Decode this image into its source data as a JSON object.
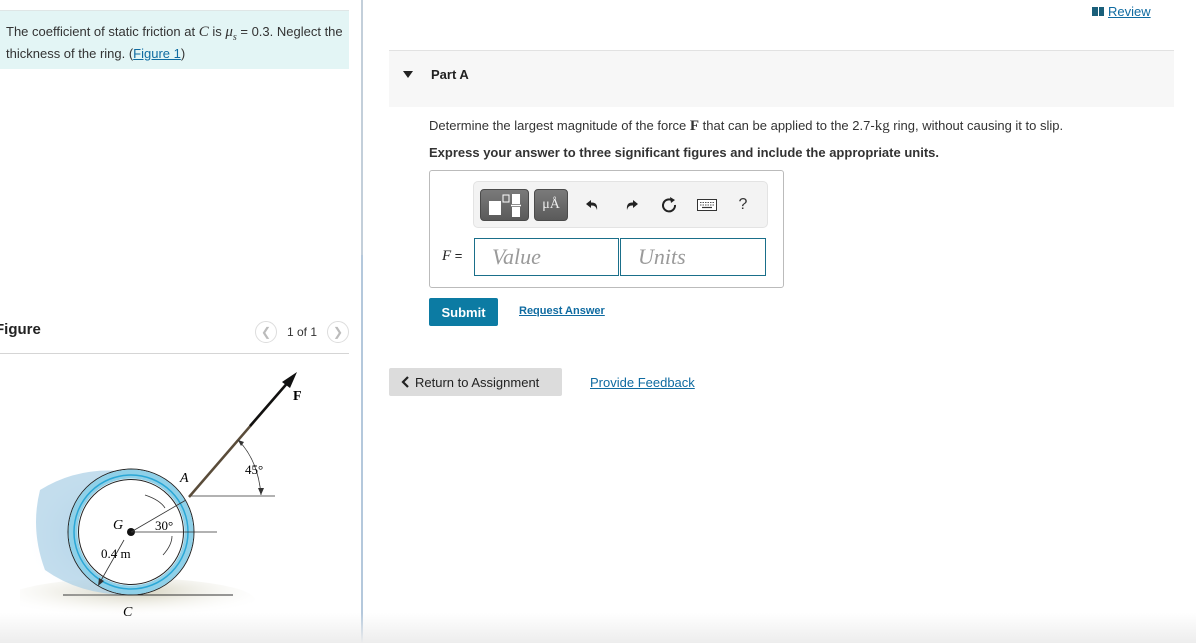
{
  "intro": {
    "text_before": "The coefficient of static friction at ",
    "point": "C",
    "text_is": " is ",
    "mu_symbol": "μ",
    "mu_sub": "s",
    "mu_value": " = 0.3. Neglect the thickness of the ring. (",
    "figure_link": "Figure 1",
    "text_after": ")"
  },
  "figure": {
    "title": "Figure",
    "counter": "1 of 1",
    "prev_icon": "chevron-left-icon",
    "next_icon": "chevron-right-icon",
    "labels": {
      "force": "F",
      "point_a": "A",
      "point_g": "G",
      "point_c": "C",
      "angle_force": "45°",
      "angle_radius": "30°",
      "radius": "0.4 m"
    },
    "colors": {
      "ring": "#6ec3e2",
      "ring_dark": "#2aa7d6",
      "shadow": "#a9cfe6",
      "ground": "#d8d6c6"
    }
  },
  "header": {
    "review_label": " Review",
    "review_icon": "book-icon"
  },
  "part": {
    "title": "Part A",
    "expanded": true,
    "question_before": "Determine the largest magnitude of the force ",
    "question_force": "F",
    "question_middle": " that can be applied to the 2.7-",
    "question_unit": "kg",
    "question_after": " ring, without causing it to slip.",
    "instruction": "Express your answer to three significant figures and include the appropriate units."
  },
  "answer": {
    "variable": "F",
    "equals": " =",
    "value_placeholder": "Value",
    "units_placeholder": "Units",
    "value": "",
    "units": "",
    "toolbar": {
      "template_icon": "templates-icon",
      "units_label": "μÅ",
      "undo_icon": "undo-icon",
      "redo_icon": "redo-icon",
      "reset_icon": "reset-icon",
      "keyboard_icon": "keyboard-icon",
      "help_label": "?"
    }
  },
  "actions": {
    "submit": "Submit",
    "request_answer": "Request Answer",
    "return": "Return to Assignment",
    "feedback": "Provide Feedback"
  },
  "colors": {
    "accent": "#0c7ba3",
    "link": "#0f6ba1",
    "intro_bg": "#e3f5f5",
    "input_border": "#1a6f8a"
  }
}
